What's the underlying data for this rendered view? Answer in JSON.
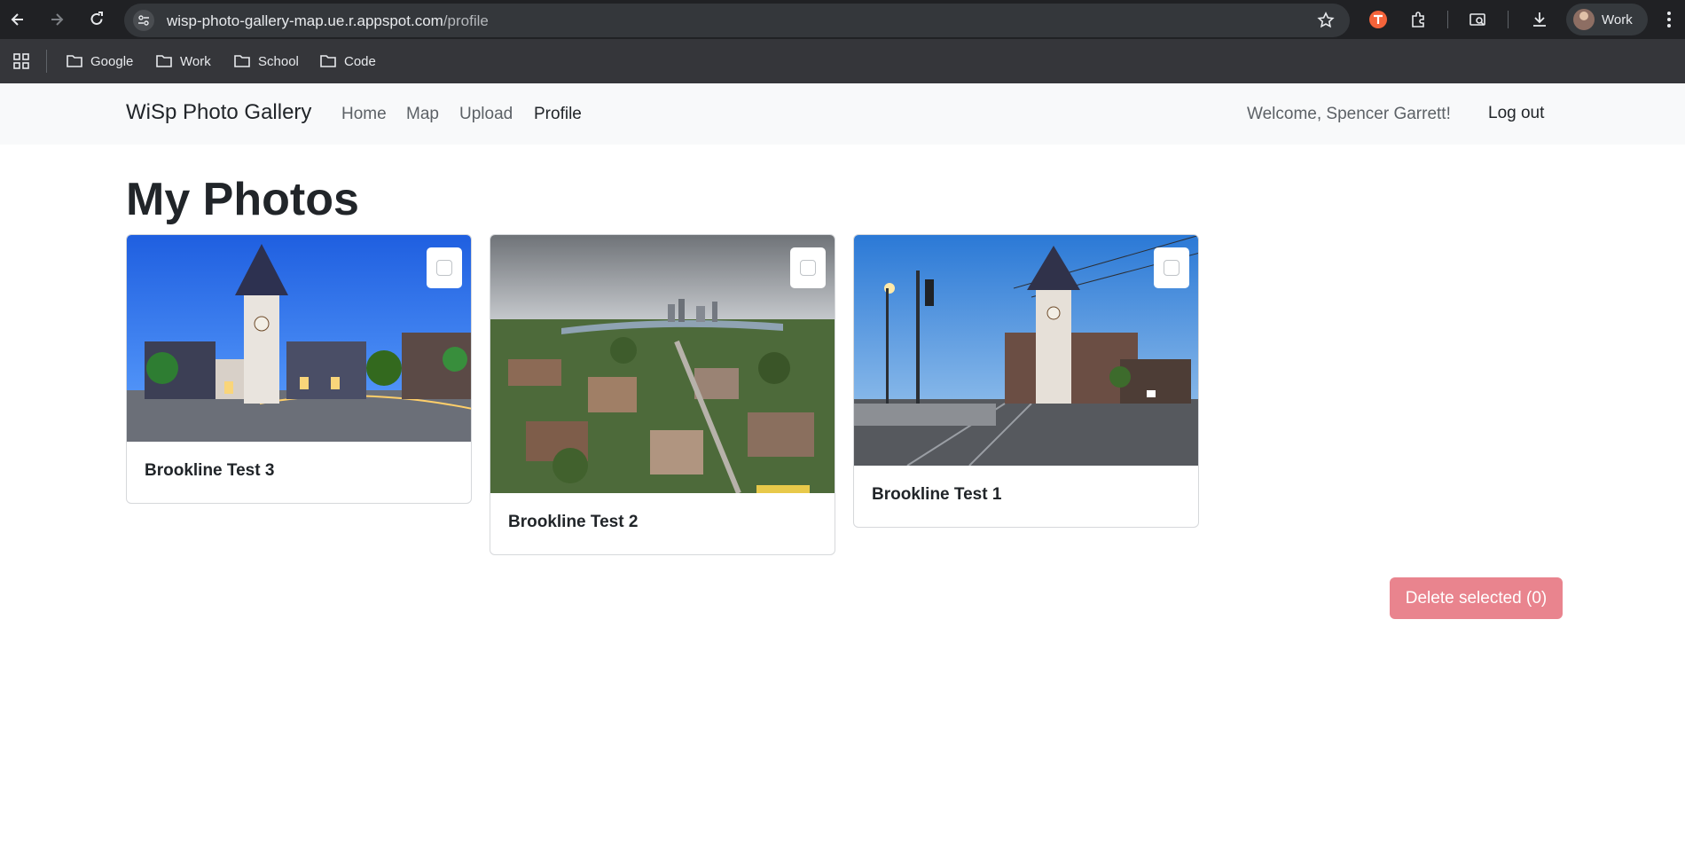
{
  "browser": {
    "url_host": "wisp-photo-gallery-map.ue.r.appspot.com",
    "url_path": "/profile",
    "profile_name": "Work",
    "bookmarks": [
      {
        "label": "Google",
        "icon": "folder-icon"
      },
      {
        "label": "Work",
        "icon": "folder-icon"
      },
      {
        "label": "School",
        "icon": "folder-icon"
      },
      {
        "label": "Code",
        "icon": "folder-icon"
      }
    ]
  },
  "navbar": {
    "brand": "WiSp Photo Gallery",
    "links": [
      "Home",
      "Map",
      "Upload",
      "Profile"
    ],
    "active": "Profile",
    "welcome": "Welcome, Spencer Garrett!",
    "logout": "Log out"
  },
  "page": {
    "title": "My Photos",
    "photos": [
      {
        "caption": "Brookline Test 3",
        "scene": "town-hall-dusk",
        "checked": false
      },
      {
        "caption": "Brookline Test 2",
        "scene": "aerial-city",
        "checked": false
      },
      {
        "caption": "Brookline Test 1",
        "scene": "street-evening",
        "checked": false
      }
    ],
    "delete_button": "Delete selected (0)"
  },
  "colors": {
    "chrome_dark": "#202124",
    "navbar_bg": "#f8f9fa",
    "danger_disabled": "#e9848e"
  }
}
